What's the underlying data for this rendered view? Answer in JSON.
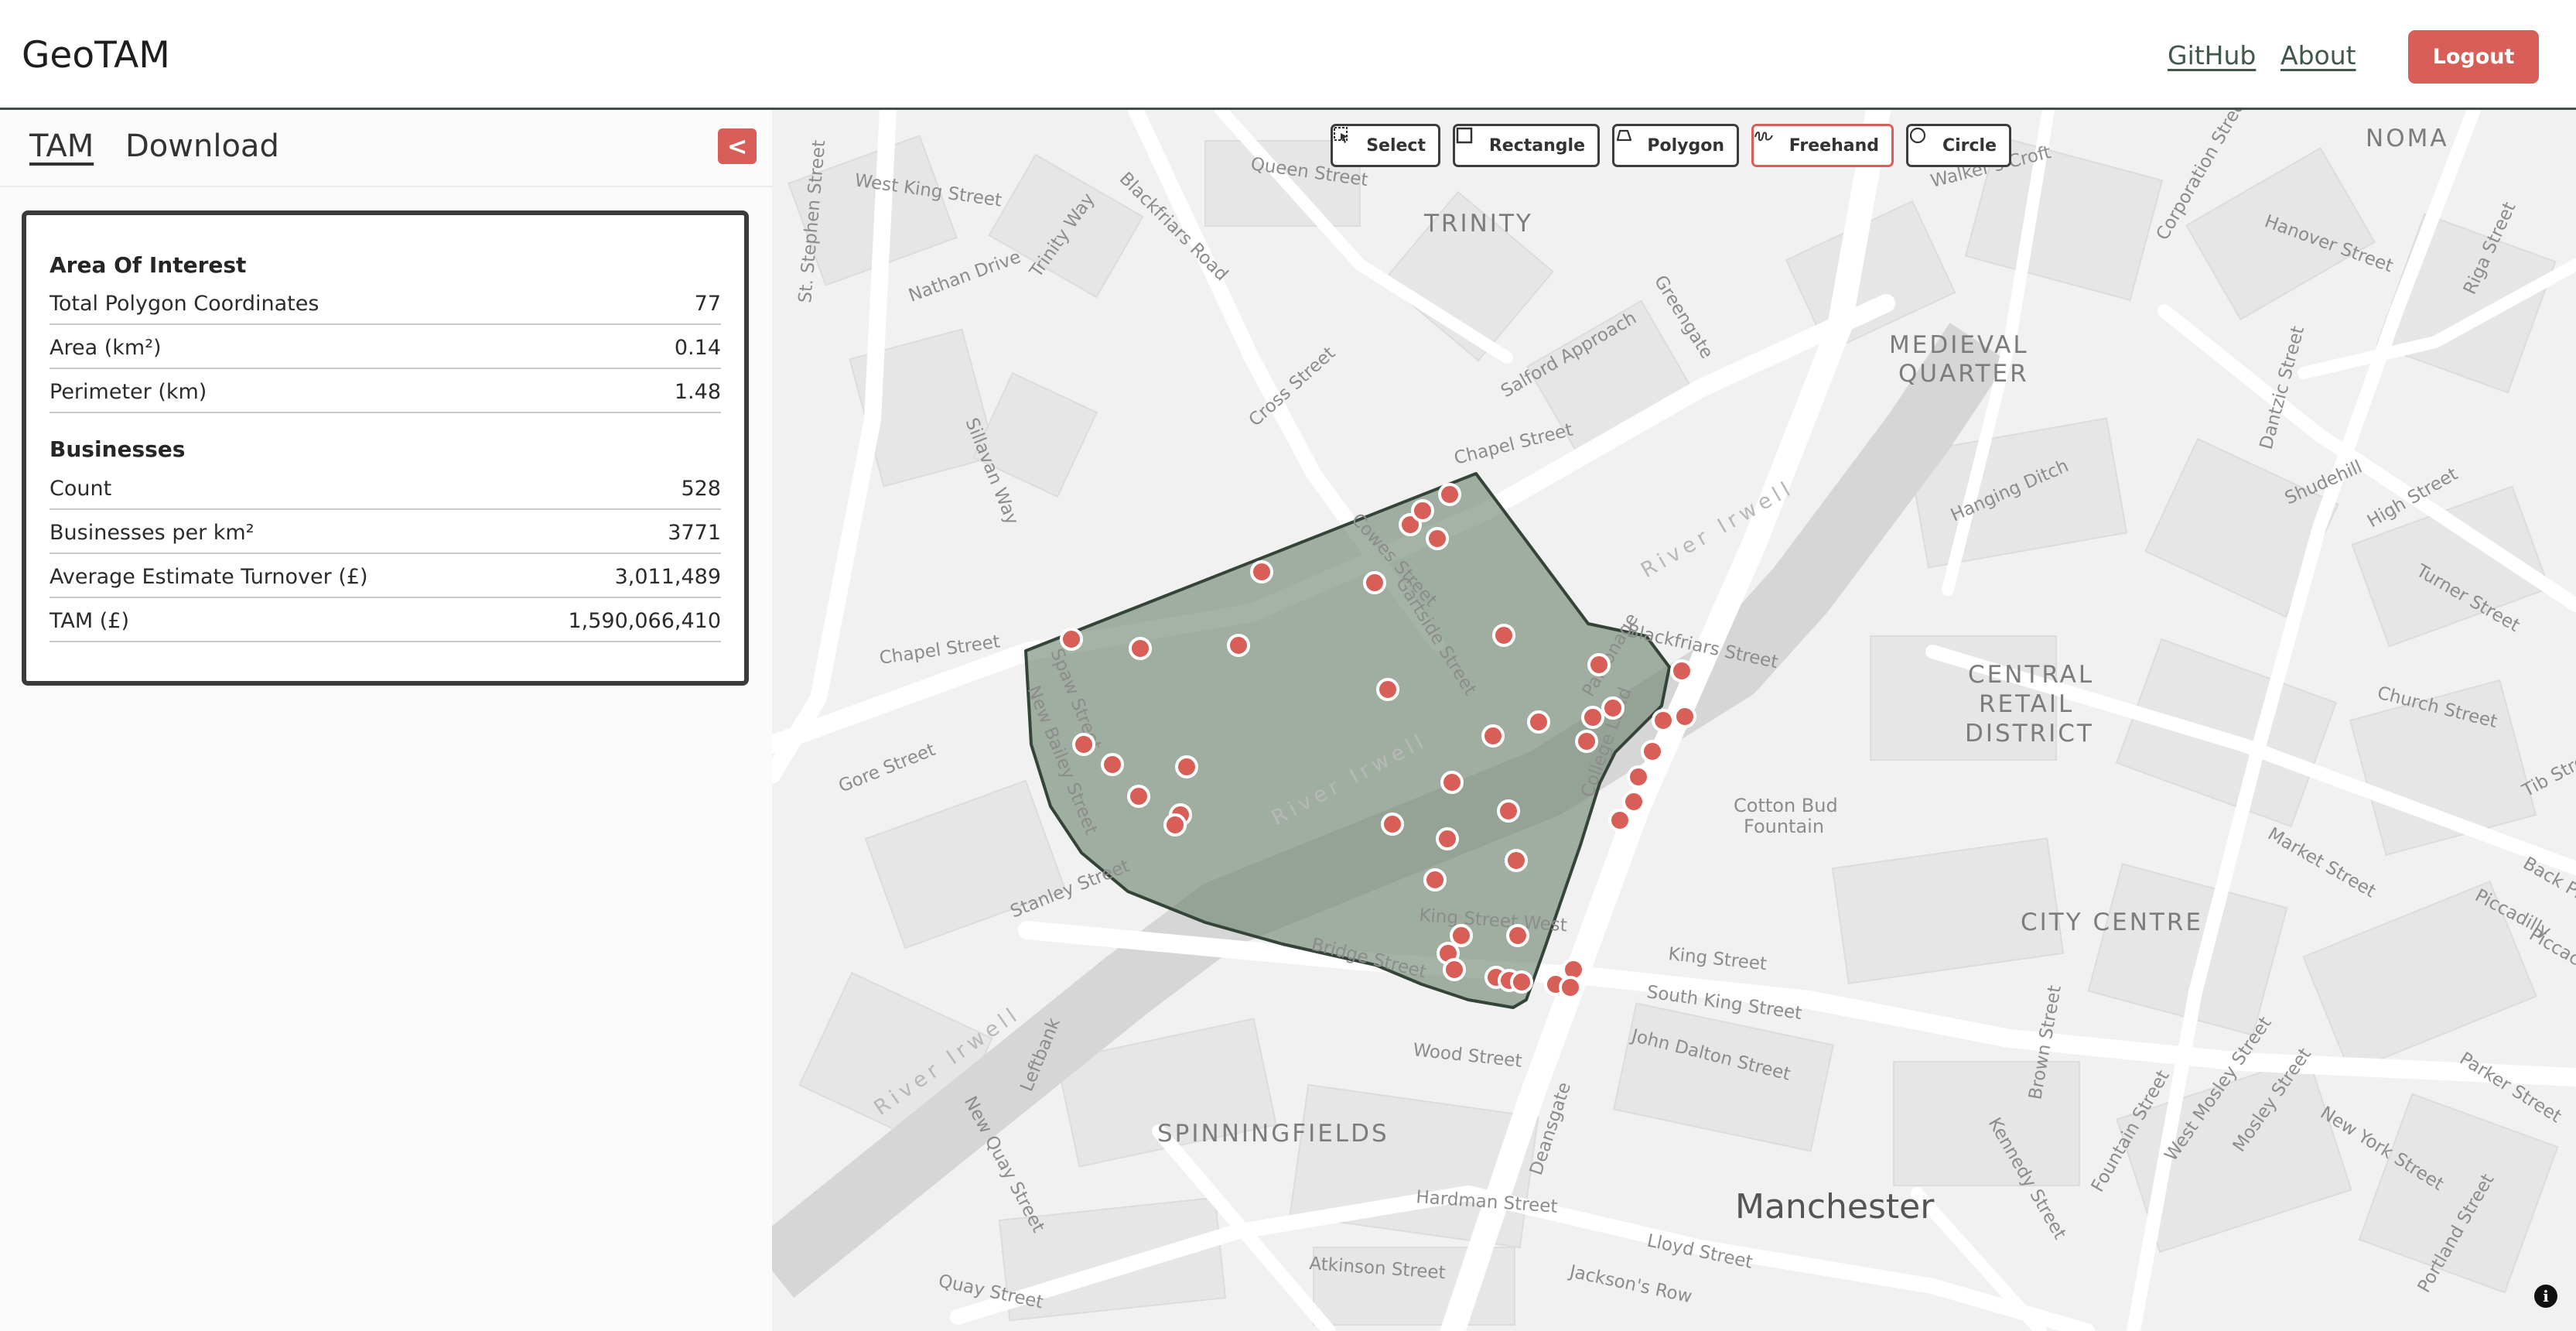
{
  "app": {
    "title": "GeoTAM"
  },
  "header": {
    "github_label": "GitHub",
    "about_label": "About",
    "logout_label": "Logout"
  },
  "sidebar": {
    "tabs": [
      {
        "label": "TAM",
        "active": true
      },
      {
        "label": "Download",
        "active": false
      }
    ],
    "collapse_label": "<",
    "area_of_interest": {
      "title": "Area Of Interest",
      "rows": [
        {
          "label": "Total Polygon Coordinates",
          "value": "77"
        },
        {
          "label": "Area (km²)",
          "value": "0.14"
        },
        {
          "label": "Perimeter (km)",
          "value": "1.48"
        }
      ]
    },
    "businesses": {
      "title": "Businesses",
      "rows": [
        {
          "label": "Count",
          "value": "528"
        },
        {
          "label": "Businesses per km²",
          "value": "3771"
        },
        {
          "label": "Average Estimate Turnover (£)",
          "value": "3,011,489"
        },
        {
          "label": "TAM (£)",
          "value": "1,590,066,410"
        }
      ]
    }
  },
  "map": {
    "tools": [
      {
        "label": "Select",
        "icon": "select-icon",
        "active": false
      },
      {
        "label": "Rectangle",
        "icon": "rectangle-icon",
        "active": false
      },
      {
        "label": "Polygon",
        "icon": "polygon-icon",
        "active": false
      },
      {
        "label": "Freehand",
        "icon": "freehand-icon",
        "active": true
      },
      {
        "label": "Circle",
        "icon": "circle-icon",
        "active": false
      }
    ],
    "districts": [
      "TRINITY",
      "NOMA",
      "MEDIEVAL",
      "QUARTER",
      "CENTRAL",
      "RETAIL",
      "DISTRICT",
      "CITY CENTRE",
      "SPINNINGFIELDS"
    ],
    "city_label": "Manchester",
    "poi": [
      "Cotton Bud",
      "Fountain"
    ],
    "river_label": "River Irwell",
    "streets": [
      "West King Street",
      "Queen Street",
      "St. Stephen Street",
      "Trinity Way",
      "Blackfriars Road",
      "Nathan Drive",
      "Cross Street",
      "Salford Approach",
      "Greengate",
      "Chapel Street",
      "Sillavan Way",
      "Gore Street",
      "Stanley Street",
      "Bridge Street",
      "Quay Street",
      "New Quay Street",
      "Leftbank",
      "Wood Street",
      "Hardman Street",
      "Atkinson Street",
      "Lloyd Street",
      "Jackson's Row",
      "King Street",
      "South King Street",
      "John Dalton Street",
      "Deansgate",
      "Parsonage",
      "College Land",
      "Cowes Street",
      "King Street West",
      "Hanover Street",
      "Corporation Street",
      "Riga Street",
      "Dantzic Street",
      "Shudehill",
      "Hanging Ditch",
      "High Street",
      "Turner Street",
      "Church Street",
      "Tib Street",
      "Market Street",
      "Back Picca",
      "Piccadilly",
      "Piccac",
      "Brown Street",
      "Fountain Street",
      "West Mosley Street",
      "Mosley Street",
      "Kennedy Street",
      "New York Street",
      "Parker Street",
      "Portland Street",
      "Walker's Croft",
      "Chapel Street",
      "Blackfriars Street",
      "New Bailey Street",
      "Spaw Street",
      "Gartside Street"
    ],
    "marker_color": "#d85f57",
    "polygon_fill": "#6e8471"
  }
}
